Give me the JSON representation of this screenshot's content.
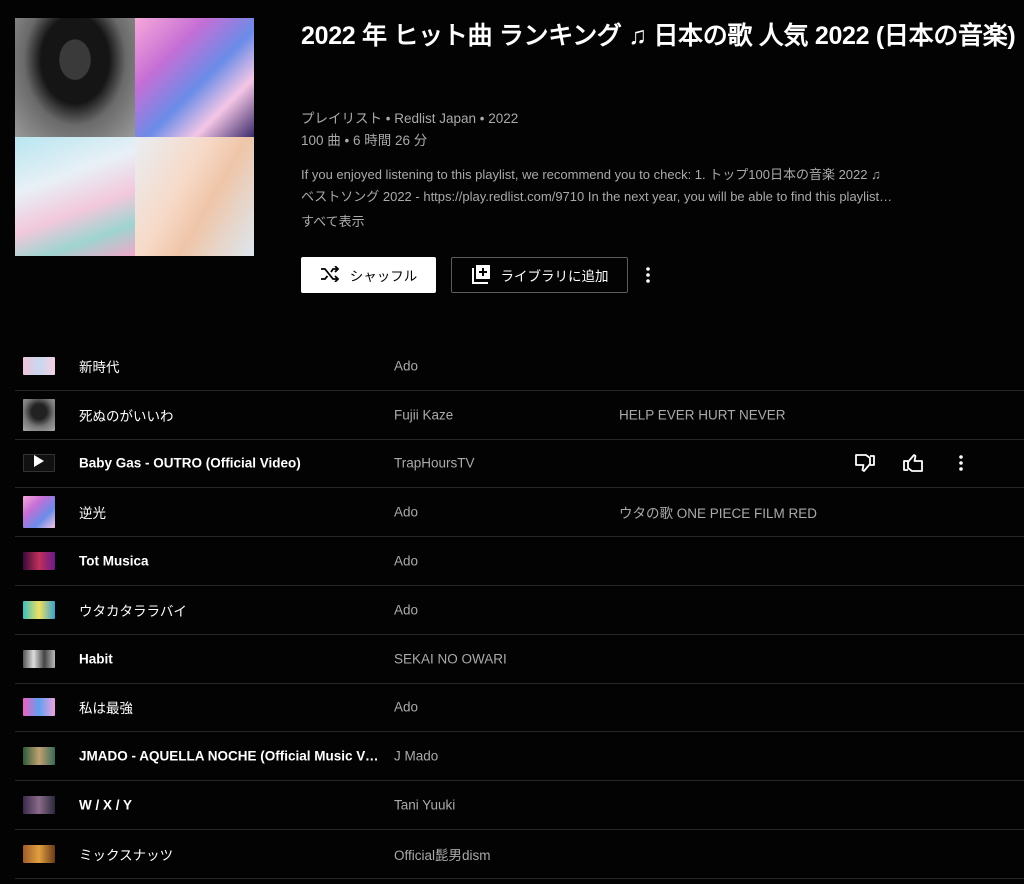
{
  "playlist": {
    "title": "2022 年 ヒット曲 ランキング ♫ 日本の歌 人気 2022 (日本の音楽)",
    "meta_line1": "プレイリスト • Redlist Japan • 2022",
    "meta_line2": "100 曲 • 6 時間 26 分",
    "description_line1": "If you enjoyed listening to this playlist, we recommend you to check: 1. トップ100日本の音楽 2022 ♫",
    "description_line2": "ベストソング 2022 - https://play.redlist.com/9710 In the next year, you will be able to find this playlist…",
    "show_more": "すべて表示",
    "shuffle_label": "シャッフル",
    "library_label": "ライブラリに追加"
  },
  "icons": {
    "shuffle": "shuffle-icon",
    "library_add": "library-add-icon",
    "more": "more-vert-icon",
    "play": "play-icon",
    "dislike": "thumb-down-icon",
    "like": "thumb-up-icon"
  },
  "tracks": [
    {
      "title": "新時代",
      "artist": "Ado",
      "album": "",
      "bold": false,
      "thumb": "linear-gradient(90deg,#f0c4d8,#c8d8f0,#f4d0e0)",
      "square": false
    },
    {
      "title": "死ぬのがいいわ",
      "artist": "Fujii Kaze",
      "album": "HELP EVER HURT NEVER",
      "bold": false,
      "thumb": "radial-gradient(circle at 50% 40%,#222 0 30%,#777 60%,#aaa 100%)",
      "square": true
    },
    {
      "title": "Baby Gas - OUTRO (Official Video)",
      "artist": "TrapHoursTV",
      "album": "",
      "bold": true,
      "thumb": "play",
      "square": false,
      "hovered": true
    },
    {
      "title": "逆光",
      "artist": "Ado",
      "album": "ウタの歌 ONE PIECE FILM RED",
      "bold": false,
      "thumb": "linear-gradient(135deg,#f7a8d8,#c56fd6,#6a8ce8,#f4c6e6)",
      "square": true
    },
    {
      "title": "Tot Musica",
      "artist": "Ado",
      "album": "",
      "bold": true,
      "thumb": "linear-gradient(90deg,#3a0a3a,#c0305a,#6a1a8a)",
      "square": false
    },
    {
      "title": "ウタカタララバイ",
      "artist": "Ado",
      "album": "",
      "bold": false,
      "thumb": "linear-gradient(90deg,#3ac0c0,#f0e060,#3aa0d0)",
      "square": false
    },
    {
      "title": "Habit",
      "artist": "SEKAI NO OWARI",
      "album": "",
      "bold": true,
      "thumb": "linear-gradient(90deg,#555,#ddd,#444,#bbb)",
      "square": false
    },
    {
      "title": "私は最強",
      "artist": "Ado",
      "album": "",
      "bold": false,
      "thumb": "linear-gradient(90deg,#f060c0,#60a0f0,#f0a0e0)",
      "square": false
    },
    {
      "title": "JMADO - AQUELLA NOCHE (Official Music Video)",
      "artist": "J Mado",
      "album": "",
      "bold": true,
      "thumb": "linear-gradient(90deg,#2a5a3a,#c0a070,#3a6a5a)",
      "square": false
    },
    {
      "title": "W / X / Y",
      "artist": "Tani Yuuki",
      "album": "",
      "bold": true,
      "thumb": "linear-gradient(90deg,#3a2a4a,#8a6a8a,#2a2a3a)",
      "square": false
    },
    {
      "title": "ミックスナッツ",
      "artist": "Official髭男dism",
      "album": "",
      "bold": false,
      "thumb": "linear-gradient(90deg,#a05a2a,#e0a040,#6a3a1a)",
      "square": false
    }
  ]
}
